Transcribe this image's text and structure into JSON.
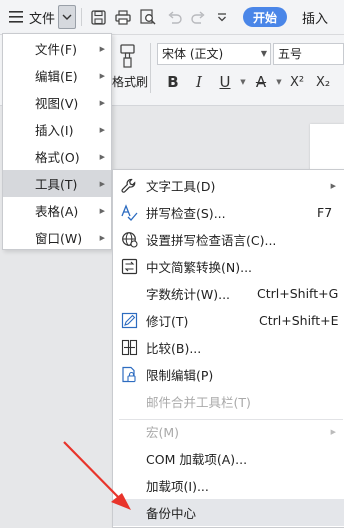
{
  "toolbar": {
    "file_label": "文件",
    "start_label": "开始",
    "insert_label": "插入"
  },
  "ribbon": {
    "format_painter_label": "格式刷",
    "font_name": "宋体 (正文)",
    "font_size": "五号",
    "bold": "B",
    "italic": "I",
    "underline": "U",
    "font_color": "A",
    "superscript": "X²",
    "subscript": "X₂"
  },
  "file_menu": {
    "items": [
      {
        "label": "文件(F)"
      },
      {
        "label": "编辑(E)"
      },
      {
        "label": "视图(V)"
      },
      {
        "label": "插入(I)"
      },
      {
        "label": "格式(O)"
      },
      {
        "label": "工具(T)"
      },
      {
        "label": "表格(A)"
      },
      {
        "label": "窗口(W)"
      }
    ]
  },
  "tools_menu": {
    "items": [
      {
        "label": "文字工具(D)",
        "icon": "wrench-icon"
      },
      {
        "label": "拼写检查(S)...",
        "shortcut": "F7",
        "icon": "spell-check-icon"
      },
      {
        "label": "设置拼写检查语言(C)...",
        "icon": "globe-icon"
      },
      {
        "label": "中文简繁转换(N)...",
        "icon": "convert-icon"
      },
      {
        "label": "字数统计(W)...",
        "shortcut": "Ctrl+Shift+G"
      },
      {
        "label": "修订(T)",
        "shortcut": "Ctrl+Shift+E",
        "icon": "track-changes-icon"
      },
      {
        "label": "比较(B)...",
        "icon": "compare-icon"
      },
      {
        "label": "限制编辑(P)",
        "icon": "restrict-edit-icon"
      },
      {
        "label": "邮件合并工具栏(T)"
      },
      {
        "label": "宏(M)"
      },
      {
        "label": "COM 加载项(A)..."
      },
      {
        "label": "加载项(I)..."
      },
      {
        "label": "备份中心"
      }
    ]
  },
  "colors": {
    "accent": "#4a86e8",
    "annotation_arrow": "#e8342b"
  }
}
